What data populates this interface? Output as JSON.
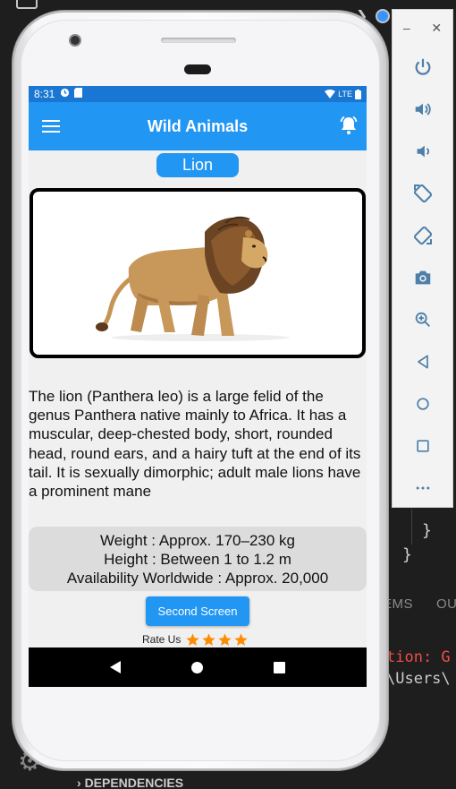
{
  "status_bar": {
    "time": "8:31",
    "network": "LTE"
  },
  "app_bar": {
    "title": "Wild Animals"
  },
  "animal": {
    "name": "Lion",
    "description": "The lion (Panthera leo) is a large felid of the genus Panthera native mainly to Africa. It has a muscular, deep-chested body, short, rounded head, round ears, and a hairy tuft at the end of its tail. It is sexually dimorphic; adult male lions have a prominent mane",
    "weight": "Weight : Approx. 170–230 kg",
    "height": "Height : Between 1 to 1.2 m",
    "availability": "Availability Worldwide : Approx. 20,000"
  },
  "buttons": {
    "second_screen": "Second Screen"
  },
  "rating": {
    "label": "Rate Us",
    "stars": 4,
    "star_color": "#ff8c00"
  },
  "vscode": {
    "panel_tab_1": "EMS",
    "panel_tab_2": "OU",
    "terminal_line_1": "tion: G",
    "terminal_line_2": "\\Users\\",
    "explorer_section": "DEPENDENCIES",
    "brace_1": "}",
    "brace_2": "}"
  },
  "colors": {
    "primary": "#2196f3",
    "status_bar": "#1976d2",
    "info_box": "#dcdcdc"
  }
}
